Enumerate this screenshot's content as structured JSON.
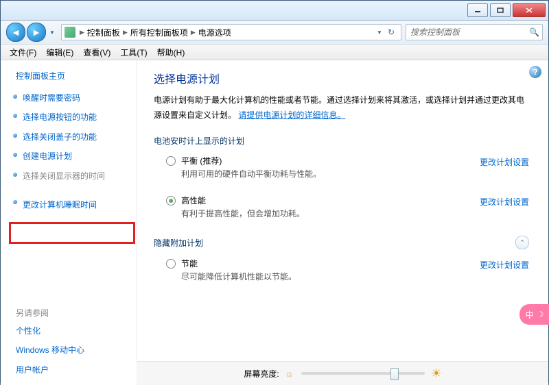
{
  "breadcrumb": {
    "items": [
      "控制面板",
      "所有控制面板项",
      "电源选项"
    ]
  },
  "search": {
    "placeholder": "搜索控制面板"
  },
  "menu": {
    "file": "文件(F)",
    "edit": "编辑(E)",
    "view": "查看(V)",
    "tools": "工具(T)",
    "help": "帮助(H)"
  },
  "sidebar": {
    "home": "控制面板主页",
    "links": [
      "唤醒时需要密码",
      "选择电源按钮的功能",
      "选择关闭盖子的功能",
      "创建电源计划",
      "选择关闭显示器的时间",
      "更改计算机睡眠时间"
    ],
    "seeAlso": "另请参阅",
    "related": [
      "个性化",
      "Windows 移动中心",
      "用户帐户"
    ]
  },
  "content": {
    "title": "选择电源计划",
    "description": "电源计划有助于最大化计算机的性能或者节能。通过选择计划来将其激活，或选择计划并通过更改其电源设置来自定义计划。",
    "infoLink": "请提供电源计划的详细信息。",
    "section1": {
      "title": "电池安时计上显示的计划",
      "plans": [
        {
          "name": "平衡 (推荐)",
          "desc": "利用可用的硬件自动平衡功耗与性能。",
          "change": "更改计划设置",
          "checked": false
        },
        {
          "name": "高性能",
          "desc": "有利于提高性能，但会增加功耗。",
          "change": "更改计划设置",
          "checked": true
        }
      ]
    },
    "section2": {
      "title": "隐藏附加计划",
      "plans": [
        {
          "name": "节能",
          "desc": "尽可能降低计算机性能以节能。",
          "change": "更改计划设置",
          "checked": false
        }
      ]
    }
  },
  "footer": {
    "brightness": "屏幕亮度:"
  },
  "pinkwidget": {
    "label": "中"
  }
}
